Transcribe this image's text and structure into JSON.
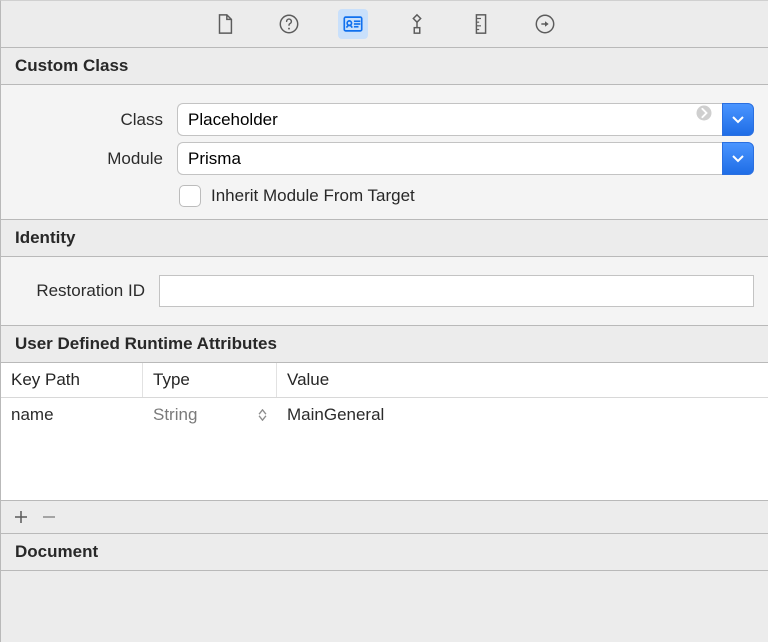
{
  "tabs": {
    "file": "file-icon",
    "help": "help-icon",
    "identity": "identity-icon",
    "attributes": "attributes-icon",
    "size": "size-icon",
    "connections": "connections-icon"
  },
  "sections": {
    "customClass": {
      "title": "Custom Class",
      "classLabel": "Class",
      "classValue": "Placeholder",
      "moduleLabel": "Module",
      "moduleValue": "Prisma",
      "inheritLabel": "Inherit Module From Target",
      "inheritChecked": false
    },
    "identity": {
      "title": "Identity",
      "restorationIdLabel": "Restoration ID",
      "restorationIdValue": ""
    },
    "udra": {
      "title": "User Defined Runtime Attributes",
      "columns": {
        "keyPath": "Key Path",
        "type": "Type",
        "value": "Value"
      },
      "rows": [
        {
          "keyPath": "name",
          "type": "String",
          "value": "MainGeneral"
        }
      ]
    },
    "document": {
      "title": "Document"
    }
  }
}
